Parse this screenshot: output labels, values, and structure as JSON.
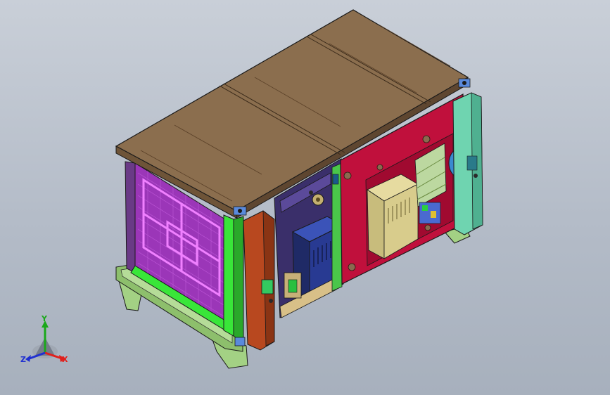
{
  "viewport": {
    "background_top": "#c9cfd8",
    "background_bottom": "#a7b0bd"
  },
  "triad": {
    "x_label": "X",
    "y_label": "Y",
    "z_label": "Z",
    "x_color": "#e0201c",
    "y_color": "#1aa81a",
    "z_color": "#2030d0"
  },
  "model": {
    "top_panel_color": "#8b6e4e",
    "mesh_color": "#b040d0",
    "frame_green": "#39e639",
    "door_red": "#c0103c",
    "side_teal": "#6fd4b0",
    "column_brown": "#b8481f",
    "box_navy": "#2a3a8a",
    "transformer_khaki": "#d8cc8c",
    "base_olive": "#9ccc80"
  }
}
